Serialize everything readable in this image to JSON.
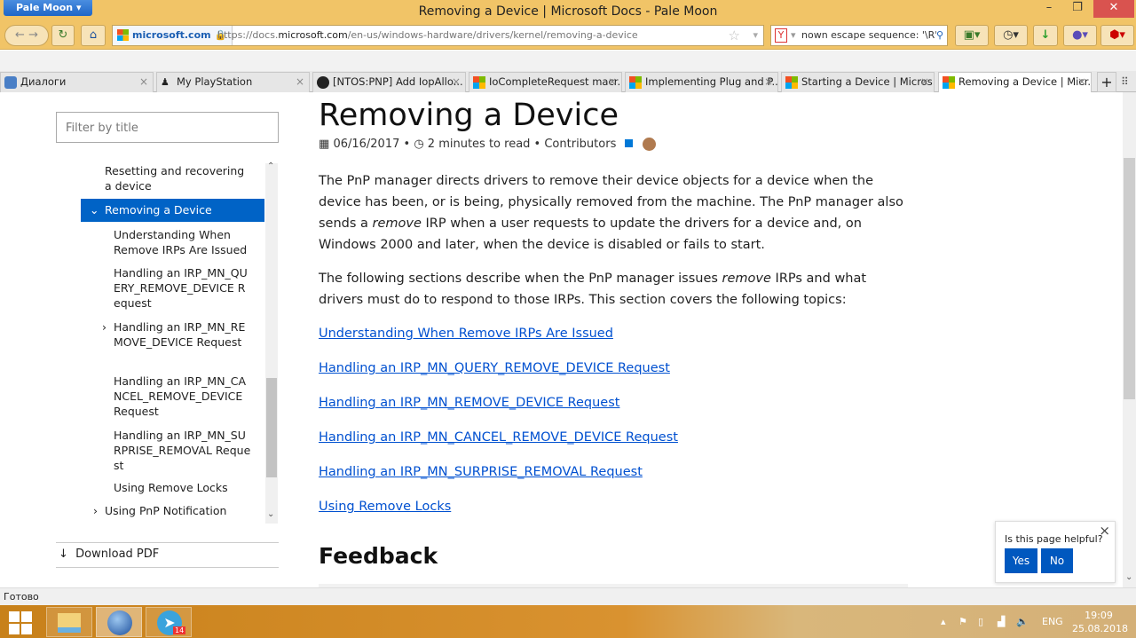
{
  "window": {
    "app_button": "Pale Moon",
    "title": "Removing a Device | Microsoft Docs - Pale Moon",
    "minimize": "–",
    "restore": "❐",
    "close": "✕"
  },
  "navbar": {
    "identity": "microsoft.com",
    "url_host_prefix": "https://docs.",
    "url_host": "microsoft.com",
    "url_path": "/en-us/windows-hardware/drivers/kernel/removing-a-device",
    "search_text": "nown escape sequence: '\\R' ["
  },
  "tabs": [
    {
      "label": "Диалоги",
      "icon": "chat-icon"
    },
    {
      "label": "My PlayStation",
      "icon": "playstation-icon"
    },
    {
      "label": "[NTOS:PNP] Add IopAllo...",
      "icon": "github-icon"
    },
    {
      "label": "IoCompleteRequest macr...",
      "icon": "microsoft-icon"
    },
    {
      "label": "Implementing Plug and P...",
      "icon": "microsoft-icon"
    },
    {
      "label": "Starting a Device | Micros...",
      "icon": "microsoft-icon"
    },
    {
      "label": "Removing a Device | Micr...",
      "icon": "microsoft-icon",
      "active": true
    }
  ],
  "sidebar": {
    "filter_placeholder": "Filter by title",
    "items": [
      "Resetting and recovering a device",
      "Removing a Device",
      "Understanding When Remove IRPs Are Issued",
      "Handling an IRP_MN_QUERY_REMOVE_DEVICE Request",
      "Handling an IRP_MN_REMOVE_DEVICE Request",
      "Handling an IRP_MN_CANCEL_REMOVE_DEVICE Request",
      "Handling an IRP_MN_SURPRISE_REMOVAL Request",
      "Using Remove Locks",
      "Using PnP Notification"
    ],
    "download_pdf": "Download PDF"
  },
  "article": {
    "title": "Removing a Device",
    "date": "06/16/2017",
    "read_time": "2 minutes to read",
    "contributors": "Contributors",
    "p1a": "The PnP manager directs drivers to remove their device objects for a device when the device has been, or is being, physically removed from the machine. The PnP manager also sends a ",
    "p1em": "remove",
    "p1b": " IRP when a user requests to update the drivers for a device and, on Windows 2000 and later, when the device is disabled or fails to start.",
    "p2a": "The following sections describe when the PnP manager issues ",
    "p2em": "remove",
    "p2b": " IRPs and what drivers must do to respond to those IRPs. This section covers the following topics:",
    "links": [
      "Understanding When Remove IRPs Are Issued",
      "Handling an IRP_MN_QUERY_REMOVE_DEVICE Request",
      "Handling an IRP_MN_REMOVE_DEVICE Request",
      "Handling an IRP_MN_CANCEL_REMOVE_DEVICE Request",
      "Handling an IRP_MN_SURPRISE_REMOVAL Request",
      "Using Remove Locks"
    ],
    "feedback": "Feedback"
  },
  "popup": {
    "question": "Is this page helpful?",
    "yes": "Yes",
    "no": "No"
  },
  "status": "Готово",
  "taskbar": {
    "telegram_badge": "14",
    "lang": "ENG",
    "time": "19:09",
    "date": "25.08.2018"
  }
}
